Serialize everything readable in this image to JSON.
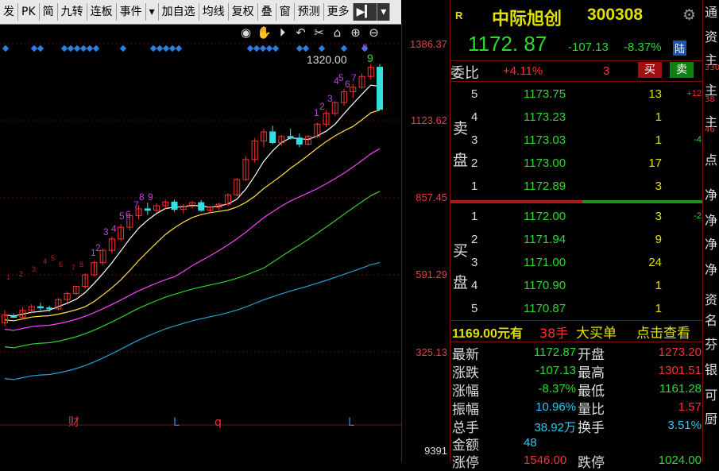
{
  "toolbar": {
    "items": [
      "发",
      "PK",
      "简",
      "九转",
      "连板",
      "事件",
      "▾",
      "加自选",
      "均线",
      "复权",
      "叠",
      "窗",
      "预测",
      "更多",
      "▶▎",
      "▾"
    ]
  },
  "axis": {
    "labels": [
      "1386.37",
      "1123.62",
      "857.45",
      "591.29",
      "325.13",
      "9391"
    ]
  },
  "chart": {
    "high_label": "1320.00",
    "high_count": "9",
    "seq_labels": [
      "1",
      "2",
      "3",
      "4",
      "5",
      "6",
      "7",
      "8",
      "9",
      "1",
      "2",
      "3",
      "4",
      "5",
      "6",
      "7",
      "8",
      "1",
      "2",
      "3",
      "4",
      "5",
      "6",
      "7",
      "8"
    ],
    "event_markers": [
      "财",
      "L",
      "q",
      "L"
    ],
    "candles": [
      [
        480,
        520,
        470,
        505
      ],
      [
        500,
        510,
        495,
        498
      ],
      [
        498,
        530,
        490,
        520
      ],
      [
        520,
        540,
        510,
        532
      ],
      [
        532,
        545,
        520,
        528
      ],
      [
        528,
        535,
        515,
        525
      ],
      [
        525,
        560,
        520,
        555
      ],
      [
        555,
        580,
        545,
        575
      ],
      [
        575,
        600,
        570,
        598
      ],
      [
        598,
        640,
        590,
        635
      ],
      [
        635,
        680,
        630,
        675
      ],
      [
        675,
        720,
        665,
        715
      ],
      [
        715,
        760,
        705,
        752
      ],
      [
        752,
        800,
        745,
        790
      ],
      [
        790,
        835,
        780,
        828
      ],
      [
        828,
        862,
        815,
        850
      ],
      [
        850,
        870,
        830,
        845
      ],
      [
        845,
        868,
        838,
        860
      ],
      [
        860,
        880,
        850,
        872
      ],
      [
        872,
        880,
        840,
        848
      ],
      [
        848,
        865,
        835,
        858
      ],
      [
        858,
        875,
        850,
        870
      ],
      [
        870,
        878,
        840,
        845
      ],
      [
        845,
        860,
        835,
        855
      ],
      [
        855,
        870,
        845,
        865
      ],
      [
        865,
        900,
        860,
        895
      ],
      [
        895,
        950,
        890,
        945
      ],
      [
        945,
        1020,
        940,
        1010
      ],
      [
        1010,
        1080,
        1000,
        1070
      ],
      [
        1070,
        1110,
        1050,
        1100
      ],
      [
        1100,
        1120,
        1060,
        1065
      ],
      [
        1065,
        1090,
        1055,
        1085
      ],
      [
        1085,
        1110,
        1075,
        1080
      ],
      [
        1080,
        1095,
        1050,
        1060
      ],
      [
        1060,
        1090,
        1055,
        1085
      ],
      [
        1085,
        1130,
        1080,
        1125
      ],
      [
        1125,
        1170,
        1115,
        1160
      ],
      [
        1160,
        1200,
        1150,
        1195
      ],
      [
        1195,
        1240,
        1185,
        1230
      ],
      [
        1230,
        1255,
        1210,
        1245
      ],
      [
        1245,
        1290,
        1240,
        1280
      ],
      [
        1280,
        1320,
        1270,
        1310
      ],
      [
        1310,
        1320,
        1240,
        1172.87
      ]
    ]
  },
  "header": {
    "tag": "R",
    "name": "中际旭创",
    "code": "300308",
    "price": "1172. 87",
    "change": "-107.13",
    "change_pct": "-8.37%",
    "exchange_badge": "陆"
  },
  "weibi": {
    "label": "委比",
    "value": "+4.11%",
    "diff": "3",
    "buy_btn": "买",
    "sell_btn": "卖"
  },
  "asks": {
    "label": "卖盘",
    "rows": [
      {
        "level": "5",
        "price": "1173.75",
        "vol": "13",
        "chg": "+12"
      },
      {
        "level": "4",
        "price": "1173.23",
        "vol": "1",
        "chg": ""
      },
      {
        "level": "3",
        "price": "1173.03",
        "vol": "1",
        "chg": "-4"
      },
      {
        "level": "2",
        "price": "1173.00",
        "vol": "17",
        "chg": ""
      },
      {
        "level": "1",
        "price": "1172.89",
        "vol": "3",
        "chg": ""
      }
    ]
  },
  "bids": {
    "label": "买盘",
    "rows": [
      {
        "level": "1",
        "price": "1172.00",
        "vol": "3",
        "chg": "-2"
      },
      {
        "level": "2",
        "price": "1171.94",
        "vol": "9",
        "chg": ""
      },
      {
        "level": "3",
        "price": "1171.00",
        "vol": "24",
        "chg": ""
      },
      {
        "level": "4",
        "price": "1170.90",
        "vol": "1",
        "chg": ""
      },
      {
        "level": "5",
        "price": "1170.87",
        "vol": "1",
        "chg": ""
      }
    ]
  },
  "big_order": {
    "price_text": "1169.00元有",
    "qty": "38手",
    "title": "大买单",
    "link": "点击查看"
  },
  "stats": {
    "latest_label": "最新",
    "latest": "1172.87",
    "open_label": "开盘",
    "open": "1273.20",
    "change_label": "涨跌",
    "change": "-107.13",
    "high_label": "最高",
    "high": "1301.51",
    "pct_label": "涨幅",
    "pct": "-8.37%",
    "low_label": "最低",
    "low": "1161.28",
    "amp_label": "振幅",
    "amp": "10.96%",
    "vr_label": "量比",
    "vr": "1.57",
    "vol_label": "总手",
    "vol": "38.92万",
    "turn_label": "换手",
    "turn": "3.51%",
    "amt_label": "金额",
    "amt": "48",
    "limitup_label": "涨停",
    "limitup": "1546.00",
    "limitdown_label": "跌停",
    "limitdown": "1024.00"
  },
  "side": {
    "chars": [
      "通",
      "资",
      "主",
      "330",
      "主",
      "38",
      "主",
      "46",
      "点",
      "净",
      "净",
      "净",
      "净",
      "资",
      "名",
      "芬",
      "银",
      "可",
      "厨"
    ]
  },
  "colors": {
    "up": "#ff3030",
    "down": "#30e0e0",
    "ma5": "#ffffff",
    "ma10": "#ffe040",
    "ma20": "#ff40ff",
    "ma30": "#30d030",
    "ma60": "#2a9fd0"
  }
}
